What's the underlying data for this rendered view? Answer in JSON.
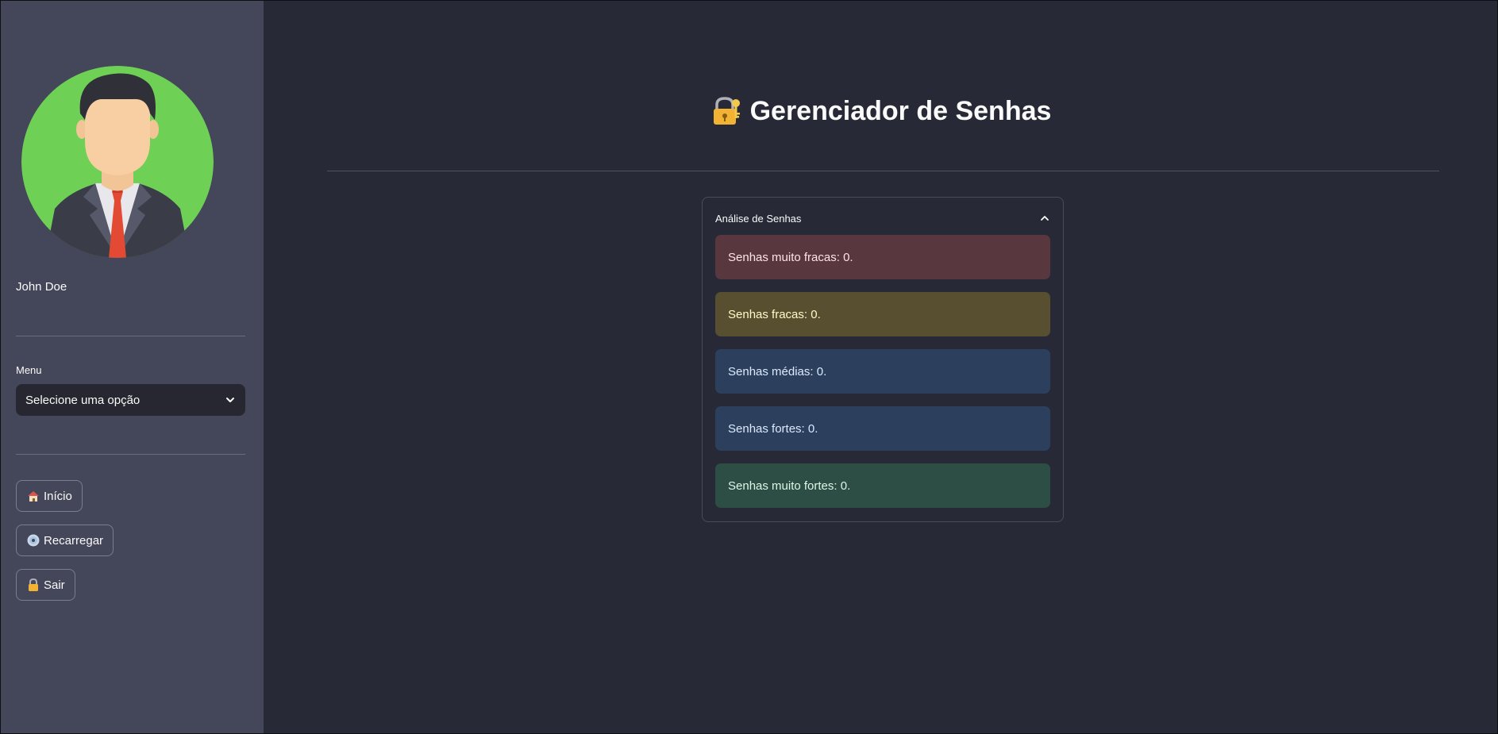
{
  "sidebar": {
    "user_name": "John Doe",
    "menu_label": "Menu",
    "menu_select_value": "Selecione uma opção",
    "buttons": [
      {
        "label": "Início",
        "icon": "house-icon"
      },
      {
        "label": "Recarregar",
        "icon": "disc-icon"
      },
      {
        "label": "Sair",
        "icon": "lock-icon"
      }
    ]
  },
  "main": {
    "title": "Gerenciador de Senhas",
    "title_icon": "lock-with-key-icon",
    "expander": {
      "title": "Análise de Senhas",
      "alerts": [
        {
          "text": "Senhas muito fracas: 0.",
          "bg": "#59373f",
          "fg": "#fde5e5"
        },
        {
          "text": "Senhas fracas: 0.",
          "bg": "#574f2f",
          "fg": "#fffac8"
        },
        {
          "text": "Senhas médias: 0.",
          "bg": "#2c3f5c",
          "fg": "#dbeafe"
        },
        {
          "text": "Senhas fortes: 0.",
          "bg": "#2c3f5c",
          "fg": "#dbeafe"
        },
        {
          "text": "Senhas muito fortes: 0.",
          "bg": "#2d4e44",
          "fg": "#dff6e8"
        }
      ]
    }
  },
  "colors": {
    "background": "#272a36",
    "sidebar": "#444659",
    "select_bg": "#262730",
    "avatar_bg": "#6ed155"
  }
}
